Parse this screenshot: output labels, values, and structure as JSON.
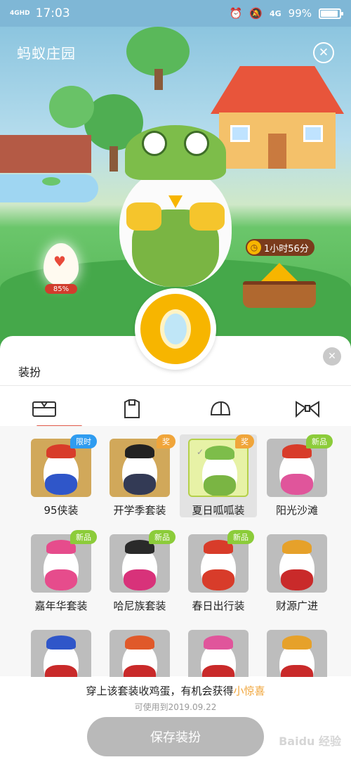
{
  "status_bar": {
    "network": "4GHD",
    "time": "17:03",
    "mobile": "4G",
    "battery": "99%"
  },
  "scene": {
    "title": "蚂蚁庄园",
    "egg_progress": "85%",
    "timer": "1小时56分"
  },
  "panel": {
    "title": "装扮",
    "tabs": [
      {
        "name": "outfit",
        "active": true
      },
      {
        "name": "clothes",
        "active": false
      },
      {
        "name": "hat",
        "active": false
      },
      {
        "name": "bow",
        "active": false
      }
    ],
    "items": [
      {
        "label": "95侠装",
        "badge": "限时",
        "badge_color": "blue",
        "thumb": "gold",
        "costume": "#2f56c9",
        "hat": "#d83c2a"
      },
      {
        "label": "开学季套装",
        "badge": "奖",
        "badge_color": "orange",
        "thumb": "gold",
        "costume": "#333a55",
        "hat": "#222222"
      },
      {
        "label": "夏日呱呱装",
        "badge": "奖",
        "badge_color": "orange",
        "thumb": "selected",
        "costume": "#7ab543",
        "hat": "#7dbd4a",
        "selected": true
      },
      {
        "label": "阳光沙滩",
        "badge": "新品",
        "badge_color": "green",
        "thumb": "gray",
        "costume": "#e0559b",
        "hat": "#d83c2a"
      },
      {
        "label": "嘉年华套装",
        "badge": "新品",
        "badge_color": "green",
        "thumb": "gray",
        "costume": "#e64c8c",
        "hat": "#e64c8c"
      },
      {
        "label": "哈尼族套装",
        "badge": "新品",
        "badge_color": "green",
        "thumb": "gray",
        "costume": "#d8327a",
        "hat": "#2a2a2a"
      },
      {
        "label": "春日出行装",
        "badge": "新品",
        "badge_color": "green",
        "thumb": "gray",
        "costume": "#d83c2a",
        "hat": "#d83c2a"
      },
      {
        "label": "财源广进",
        "badge": "",
        "badge_color": "",
        "thumb": "gray",
        "costume": "#c92a2a",
        "hat": "#e6a12a"
      },
      {
        "label": "",
        "badge": "",
        "badge_color": "",
        "thumb": "gray",
        "costume": "#c92a2a",
        "hat": "#2f56c9"
      },
      {
        "label": "",
        "badge": "",
        "badge_color": "",
        "thumb": "gray",
        "costume": "#c92a2a",
        "hat": "#e0592a"
      },
      {
        "label": "",
        "badge": "",
        "badge_color": "",
        "thumb": "gray",
        "costume": "#c92a2a",
        "hat": "#e0559b"
      },
      {
        "label": "",
        "badge": "",
        "badge_color": "",
        "thumb": "gray",
        "costume": "#c92a2a",
        "hat": "#e6a12a"
      }
    ]
  },
  "footer": {
    "hint_prefix": "穿上该套装收鸡蛋，有机会获得",
    "hint_accent": "小惊喜",
    "valid_until": "可使用到2019.09.22",
    "save_label": "保存装扮"
  },
  "watermark": "Baidu 经验",
  "colors": {
    "accent": "#f0a53a",
    "tab_underline": "#e0594a",
    "save_button": "#b9b9b9"
  }
}
